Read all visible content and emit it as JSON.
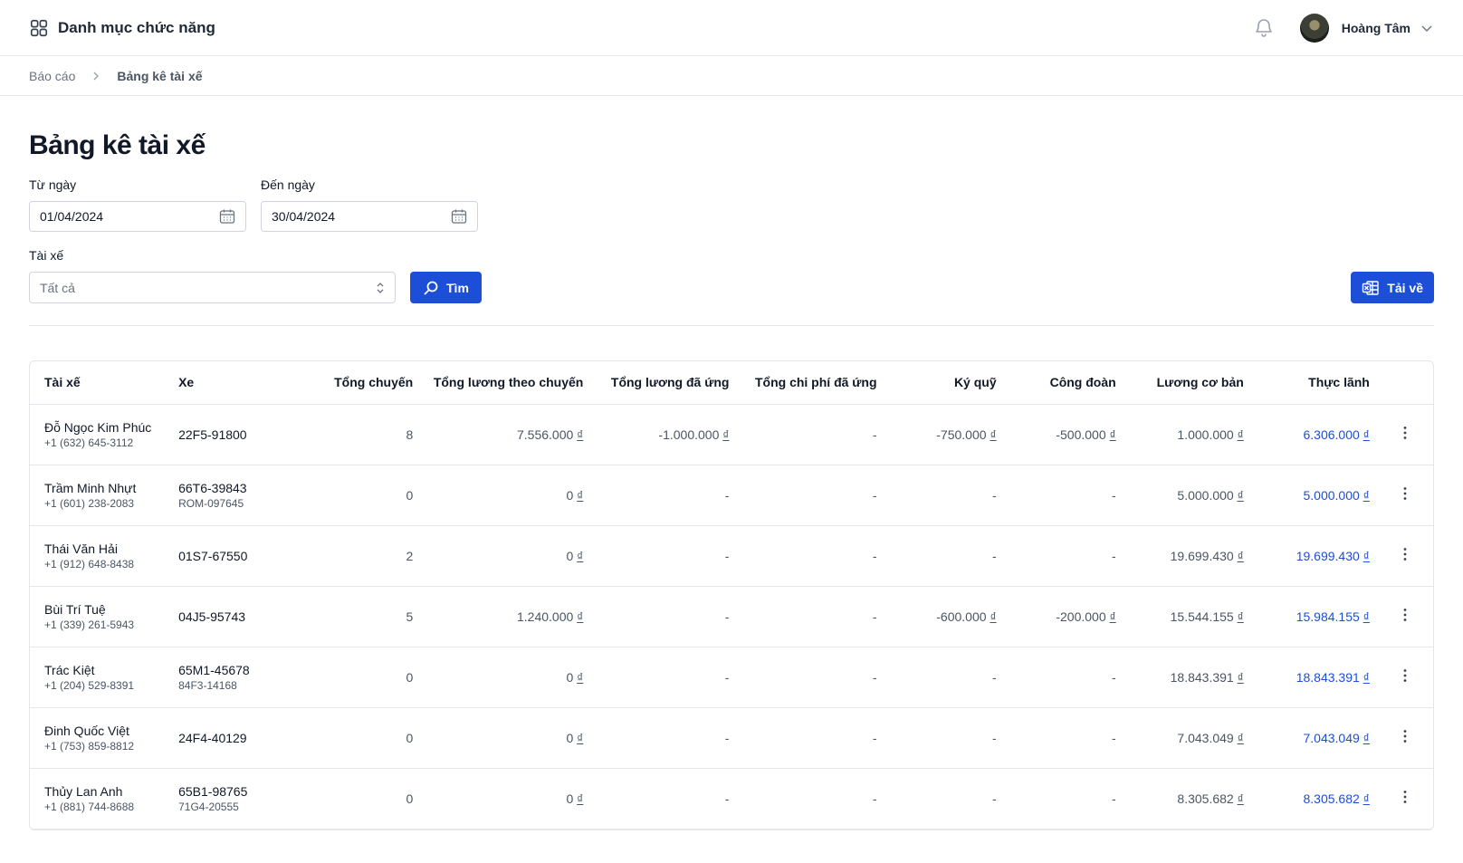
{
  "topbar": {
    "menu_title": "Danh mục chức năng",
    "user_name": "Hoàng Tâm"
  },
  "breadcrumb": {
    "parent": "Báo cáo",
    "current": "Bảng kê tài xế"
  },
  "page": {
    "title": "Bảng kê tài xế"
  },
  "filters": {
    "from_label": "Từ ngày",
    "from_value": "01/04/2024",
    "to_label": "Đến ngày",
    "to_value": "30/04/2024",
    "driver_label": "Tài xế",
    "driver_value": "Tất cả",
    "search_button": "Tìm",
    "download_button": "Tải về"
  },
  "colors": {
    "primary": "#1d4ed8",
    "border": "#e5e7eb",
    "text": "#111827",
    "muted": "#4b5563"
  },
  "icons": {
    "menu": "grid-icon",
    "notifications": "bell-icon",
    "user_menu": "chevron-down-icon",
    "breadcrumb_separator": "chevron-right-icon",
    "date": "calendar-icon",
    "select": "updown-chevron-icon",
    "search": "search-icon",
    "download": "excel-icon",
    "row_actions": "kebab-icon"
  },
  "table": {
    "columns": [
      "Tài xế",
      "Xe",
      "Tổng chuyến",
      "Tổng lương theo chuyến",
      "Tổng lương đã ứng",
      "Tổng chi phí đã ứng",
      "Ký quỹ",
      "Công đoàn",
      "Lương cơ bản",
      "Thực lãnh"
    ],
    "rows": [
      {
        "name": "Đỗ Ngọc Kim Phúc",
        "phone": "+1 (632) 645-3112",
        "plate": "22F5-91800",
        "plate2": "",
        "trips": "8",
        "trip_salary": "7.556.000",
        "advanced_salary": "-1.000.000",
        "advanced_cost": "-",
        "deposit": "-750.000",
        "union": "-500.000",
        "base_salary": "1.000.000",
        "net": "6.306.000"
      },
      {
        "name": "Trầm Minh Nhựt",
        "phone": "+1 (601) 238-2083",
        "plate": "66T6-39843",
        "plate2": "ROM-097645",
        "trips": "0",
        "trip_salary": "0",
        "advanced_salary": "-",
        "advanced_cost": "-",
        "deposit": "-",
        "union": "-",
        "base_salary": "5.000.000",
        "net": "5.000.000"
      },
      {
        "name": "Thái Văn Hải",
        "phone": "+1 (912) 648-8438",
        "plate": "01S7-67550",
        "plate2": "",
        "trips": "2",
        "trip_salary": "0",
        "advanced_salary": "-",
        "advanced_cost": "-",
        "deposit": "-",
        "union": "-",
        "base_salary": "19.699.430",
        "net": "19.699.430"
      },
      {
        "name": "Bùi Trí Tuệ",
        "phone": "+1 (339) 261-5943",
        "plate": "04J5-95743",
        "plate2": "",
        "trips": "5",
        "trip_salary": "1.240.000",
        "advanced_salary": "-",
        "advanced_cost": "-",
        "deposit": "-600.000",
        "union": "-200.000",
        "base_salary": "15.544.155",
        "net": "15.984.155"
      },
      {
        "name": "Trác Kiệt",
        "phone": "+1 (204) 529-8391",
        "plate": "65M1-45678",
        "plate2": "84F3-14168",
        "trips": "0",
        "trip_salary": "0",
        "advanced_salary": "-",
        "advanced_cost": "-",
        "deposit": "-",
        "union": "-",
        "base_salary": "18.843.391",
        "net": "18.843.391"
      },
      {
        "name": "Đinh Quốc Việt",
        "phone": "+1 (753) 859-8812",
        "plate": "24F4-40129",
        "plate2": "",
        "trips": "0",
        "trip_salary": "0",
        "advanced_salary": "-",
        "advanced_cost": "-",
        "deposit": "-",
        "union": "-",
        "base_salary": "7.043.049",
        "net": "7.043.049"
      },
      {
        "name": "Thủy Lan Anh",
        "phone": "+1 (881) 744-8688",
        "plate": "65B1-98765",
        "plate2": "71G4-20555",
        "trips": "0",
        "trip_salary": "0",
        "advanced_salary": "-",
        "advanced_cost": "-",
        "deposit": "-",
        "union": "-",
        "base_salary": "8.305.682",
        "net": "8.305.682"
      }
    ],
    "currency": "₫"
  }
}
